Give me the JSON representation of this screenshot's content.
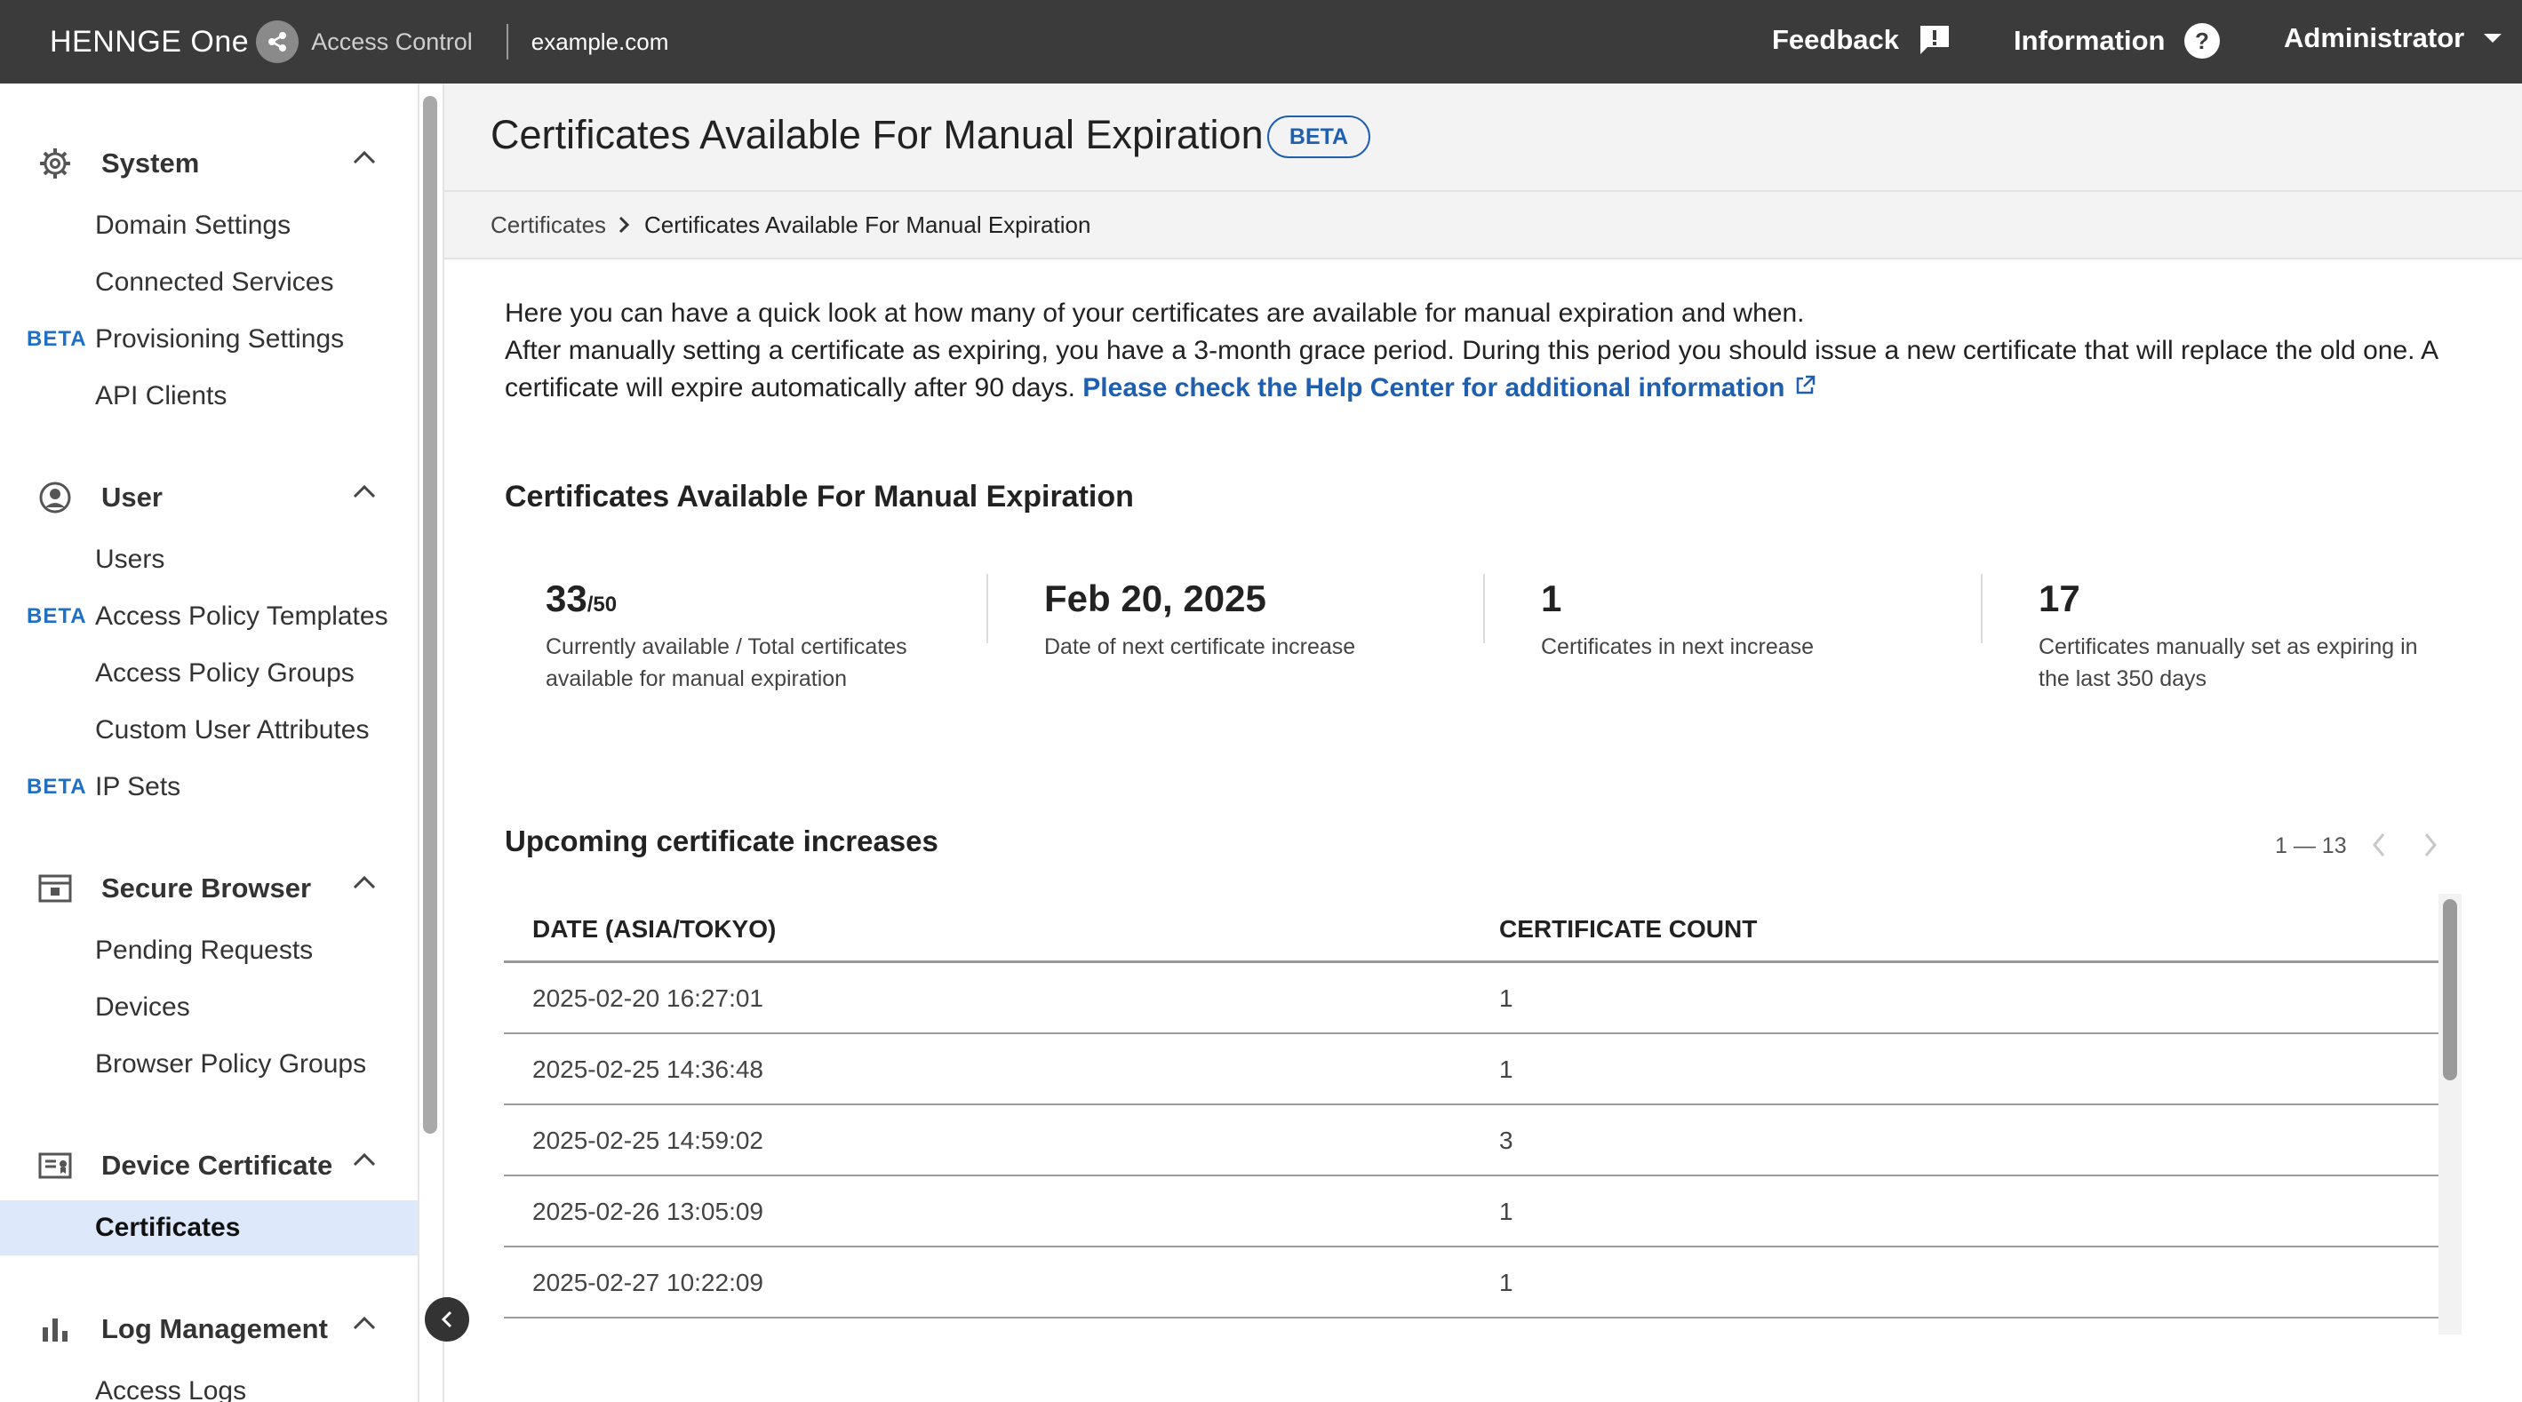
{
  "topbar": {
    "brand_name": "HENNGE One",
    "product": "Access Control",
    "domain": "example.com",
    "feedback": "Feedback",
    "information": "Information",
    "user": "Administrator"
  },
  "sidebar": {
    "sections": [
      {
        "label": "System",
        "icon": "gear-icon",
        "items": [
          "Domain Settings",
          "Connected Services",
          "Provisioning Settings",
          "API Clients"
        ]
      },
      {
        "label": "User",
        "icon": "user-circle-icon",
        "items": [
          "Users",
          "Access Policy Templates",
          "Access Policy Groups",
          "Custom User Attributes",
          "IP Sets"
        ]
      },
      {
        "label": "Secure Browser",
        "icon": "browser-window-icon",
        "items": [
          "Pending Requests",
          "Devices",
          "Browser Policy Groups"
        ]
      },
      {
        "label": "Device Certificate",
        "icon": "certificate-icon",
        "items": [
          "Certificates"
        ]
      },
      {
        "label": "Log Management",
        "icon": "bar-chart-icon",
        "items": [
          "Access Logs"
        ]
      }
    ],
    "beta_tag": "BETA",
    "active_item": "Certificates"
  },
  "page": {
    "title": "Certificates Available For Manual Expiration",
    "beta": "BETA",
    "breadcrumb_parent": "Certificates",
    "breadcrumb_current": "Certificates Available For Manual Expiration",
    "intro_line1": "Here you can have a quick look at how many of your certificates are available for manual expiration and when.",
    "intro_line2": "After manually setting a certificate as expiring, you have a 3-month grace period. During this period you should issue a new certificate that will replace the old one. A certificate will expire automatically after 90 days.",
    "help_link": "Please check the Help Center for additional information"
  },
  "summary": {
    "heading": "Certificates Available For Manual Expiration",
    "available": "33",
    "total": "/50",
    "available_label": "Currently available / Total certificates available for manual expiration",
    "next_date": "Feb 20, 2025",
    "next_date_label": "Date of next certificate increase",
    "next_count": "1",
    "next_count_label": "Certificates in next increase",
    "manual_count": "17",
    "manual_count_label": "Certificates manually set as expiring in the last 350 days"
  },
  "upcoming": {
    "heading": "Upcoming certificate increases",
    "pager": "1 — 13",
    "columns": [
      "DATE (ASIA/TOKYO)",
      "CERTIFICATE COUNT"
    ],
    "rows": [
      [
        "2025-02-20 16:27:01",
        "1"
      ],
      [
        "2025-02-25 14:36:48",
        "1"
      ],
      [
        "2025-02-25 14:59:02",
        "3"
      ],
      [
        "2025-02-26 13:05:09",
        "1"
      ],
      [
        "2025-02-27 10:22:09",
        "1"
      ]
    ]
  },
  "colors": {
    "topbar": "#3b3b3b",
    "accent": "#1f5fb0",
    "beta_text": "#1f6fc5",
    "active_bg": "#dde9fb"
  }
}
